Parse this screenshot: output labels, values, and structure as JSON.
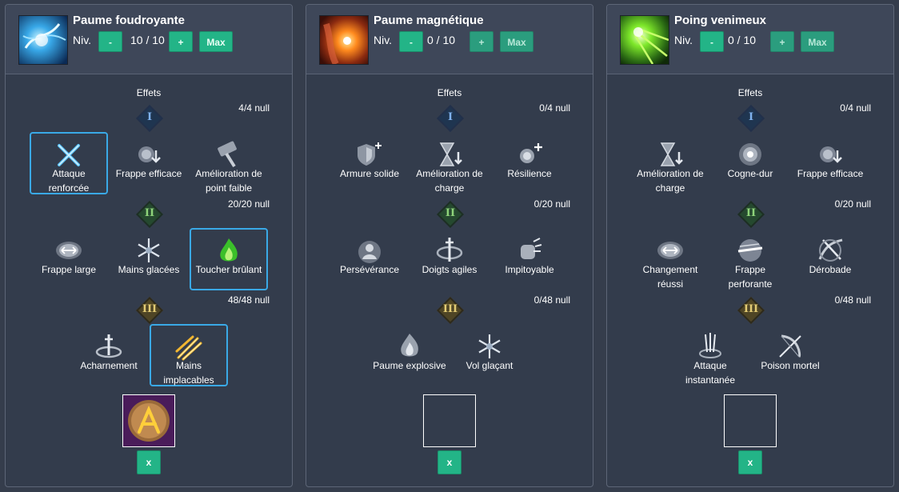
{
  "common": {
    "level_label": "Niv.",
    "minus": "-",
    "plus": "+",
    "max": "Max",
    "effects_title": "Effets",
    "remove": "x"
  },
  "panels": [
    {
      "title": "Paume foudroyante",
      "level": "10 / 10",
      "tier_counters": [
        "4/4 null",
        "20/20 null",
        "48/48 null"
      ],
      "tiers": [
        "I",
        "II",
        "III"
      ],
      "skills_t1": [
        "Attaque renforcée",
        "Frappe efficace",
        "Amélioration de point faible"
      ],
      "skills_t2": [
        "Frappe large",
        "Mains glacées",
        "Toucher brûlant"
      ],
      "skills_t3": [
        "Acharnement",
        "Mains implacables"
      ]
    },
    {
      "title": "Paume magnétique",
      "level": "0 / 10",
      "tier_counters": [
        "0/4 null",
        "0/20 null",
        "0/48 null"
      ],
      "tiers": [
        "I",
        "II",
        "III"
      ],
      "skills_t1": [
        "Armure solide",
        "Amélioration de charge",
        "Résilience"
      ],
      "skills_t2": [
        "Persévérance",
        "Doigts agiles",
        "Impitoyable"
      ],
      "skills_t3": [
        "Paume explosive",
        "Vol glaçant"
      ]
    },
    {
      "title": "Poing venimeux",
      "level": "0 / 10",
      "tier_counters": [
        "0/4 null",
        "0/20 null",
        "0/48 null"
      ],
      "tiers": [
        "I",
        "II",
        "III"
      ],
      "skills_t1": [
        "Amélioration de charge",
        "Cogne-dur",
        "Frappe efficace"
      ],
      "skills_t2": [
        "Changement réussi",
        "Frappe perforante",
        "Dérobade"
      ],
      "skills_t3": [
        "Attaque instantanée",
        "Poison mortel"
      ]
    }
  ],
  "colors": {
    "accent": "#23b487",
    "selection": "#3aa9e6",
    "panel_bg": "#333c4c",
    "header_bg": "#3e4759"
  }
}
